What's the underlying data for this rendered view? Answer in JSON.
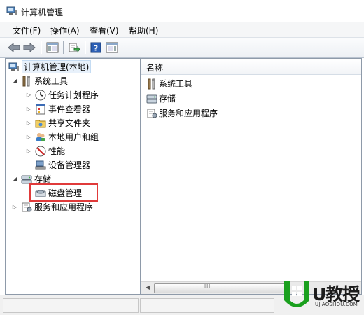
{
  "window": {
    "title": "计算机管理"
  },
  "menu": {
    "items": [
      "文件(F)",
      "操作(A)",
      "查看(V)",
      "帮助(H)"
    ]
  },
  "toolbar": {
    "buttons": [
      "back-icon",
      "forward-icon",
      "show-hide-tree-icon",
      "export-list-icon",
      "help-icon",
      "show-hide-action-pane-icon"
    ]
  },
  "tree": {
    "root": "计算机管理(本地)",
    "system_tools": "系统工具",
    "task_scheduler": "任务计划程序",
    "event_viewer": "事件查看器",
    "shared_folders": "共享文件夹",
    "local_users": "本地用户和组",
    "performance": "性能",
    "device_manager": "设备管理器",
    "storage": "存储",
    "disk_management": "磁盘管理",
    "services_apps": "服务和应用程序"
  },
  "list": {
    "column_name": "名称",
    "items": [
      "系统工具",
      "存储",
      "服务和应用程序"
    ]
  },
  "scrollbar": {
    "grip": "III"
  },
  "watermark": {
    "brand": "U教授",
    "url": "UJIAOSHOU.COM"
  },
  "colors": {
    "highlight": "#e03a3a",
    "selection": "#e8f1fb",
    "watermark_green": "#1aa01e"
  }
}
